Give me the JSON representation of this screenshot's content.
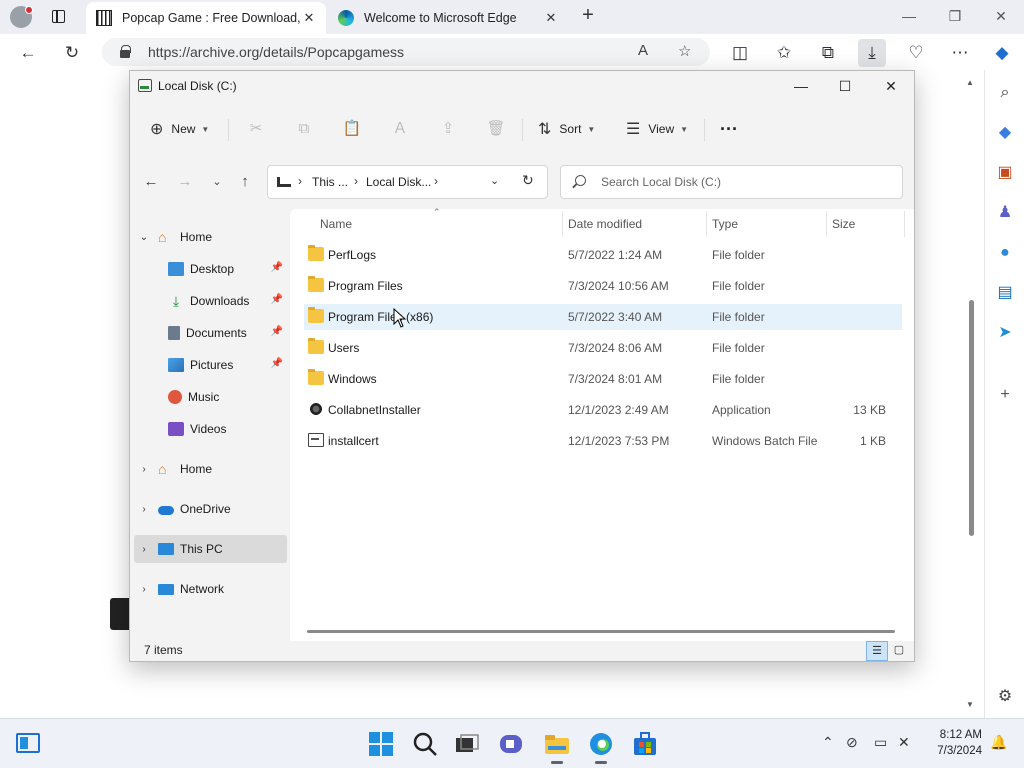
{
  "browser": {
    "tabs": [
      {
        "title": "Popcap Game : Free Download, Bo",
        "icon": "archive-icon"
      },
      {
        "title": "Welcome to Microsoft Edge",
        "icon": "edge-icon"
      }
    ],
    "url": "https://archive.org/details/Popcapgamess"
  },
  "explorer": {
    "title": "Local Disk (C:)",
    "toolbar": {
      "new_label": "New",
      "sort_label": "Sort",
      "view_label": "View"
    },
    "breadcrumb": [
      "This ...",
      "Local Disk..."
    ],
    "search_placeholder": "Search Local Disk (C:)",
    "nav_pane": {
      "quick_access": [
        {
          "label": "Home"
        },
        {
          "label": "Desktop",
          "icon": "desktop-icon"
        },
        {
          "label": "Downloads",
          "icon": "downloads-icon"
        },
        {
          "label": "Documents",
          "icon": "documents-icon"
        },
        {
          "label": "Pictures",
          "icon": "pictures-icon"
        },
        {
          "label": "Music",
          "icon": "music-icon"
        },
        {
          "label": "Videos",
          "icon": "videos-icon"
        }
      ],
      "roots": [
        {
          "label": "Home"
        },
        {
          "label": "OneDrive"
        },
        {
          "label": "This PC"
        },
        {
          "label": "Network"
        }
      ]
    },
    "columns": {
      "name": "Name",
      "date": "Date modified",
      "type": "Type",
      "size": "Size"
    },
    "files": [
      {
        "name": "PerfLogs",
        "date": "5/7/2022 1:24 AM",
        "type": "File folder",
        "size": "",
        "icon": "folder-icon"
      },
      {
        "name": "Program Files",
        "date": "7/3/2024 10:56 AM",
        "type": "File folder",
        "size": "",
        "icon": "folder-icon"
      },
      {
        "name": "Program Files (x86)",
        "date": "5/7/2022 3:40 AM",
        "type": "File folder",
        "size": "",
        "icon": "folder-icon"
      },
      {
        "name": "Users",
        "date": "7/3/2024 8:06 AM",
        "type": "File folder",
        "size": "",
        "icon": "folder-icon"
      },
      {
        "name": "Windows",
        "date": "7/3/2024 8:01 AM",
        "type": "File folder",
        "size": "",
        "icon": "folder-icon"
      },
      {
        "name": "CollabnetInstaller",
        "date": "12/1/2023 2:49 AM",
        "type": "Application",
        "size": "13 KB",
        "icon": "application-icon"
      },
      {
        "name": "installcert",
        "date": "12/1/2023 7:53 PM",
        "type": "Windows Batch File",
        "size": "1 KB",
        "icon": "batch-file-icon"
      }
    ],
    "status": "7 items"
  },
  "taskbar": {
    "time": "8:12 AM",
    "date": "7/3/2024"
  }
}
